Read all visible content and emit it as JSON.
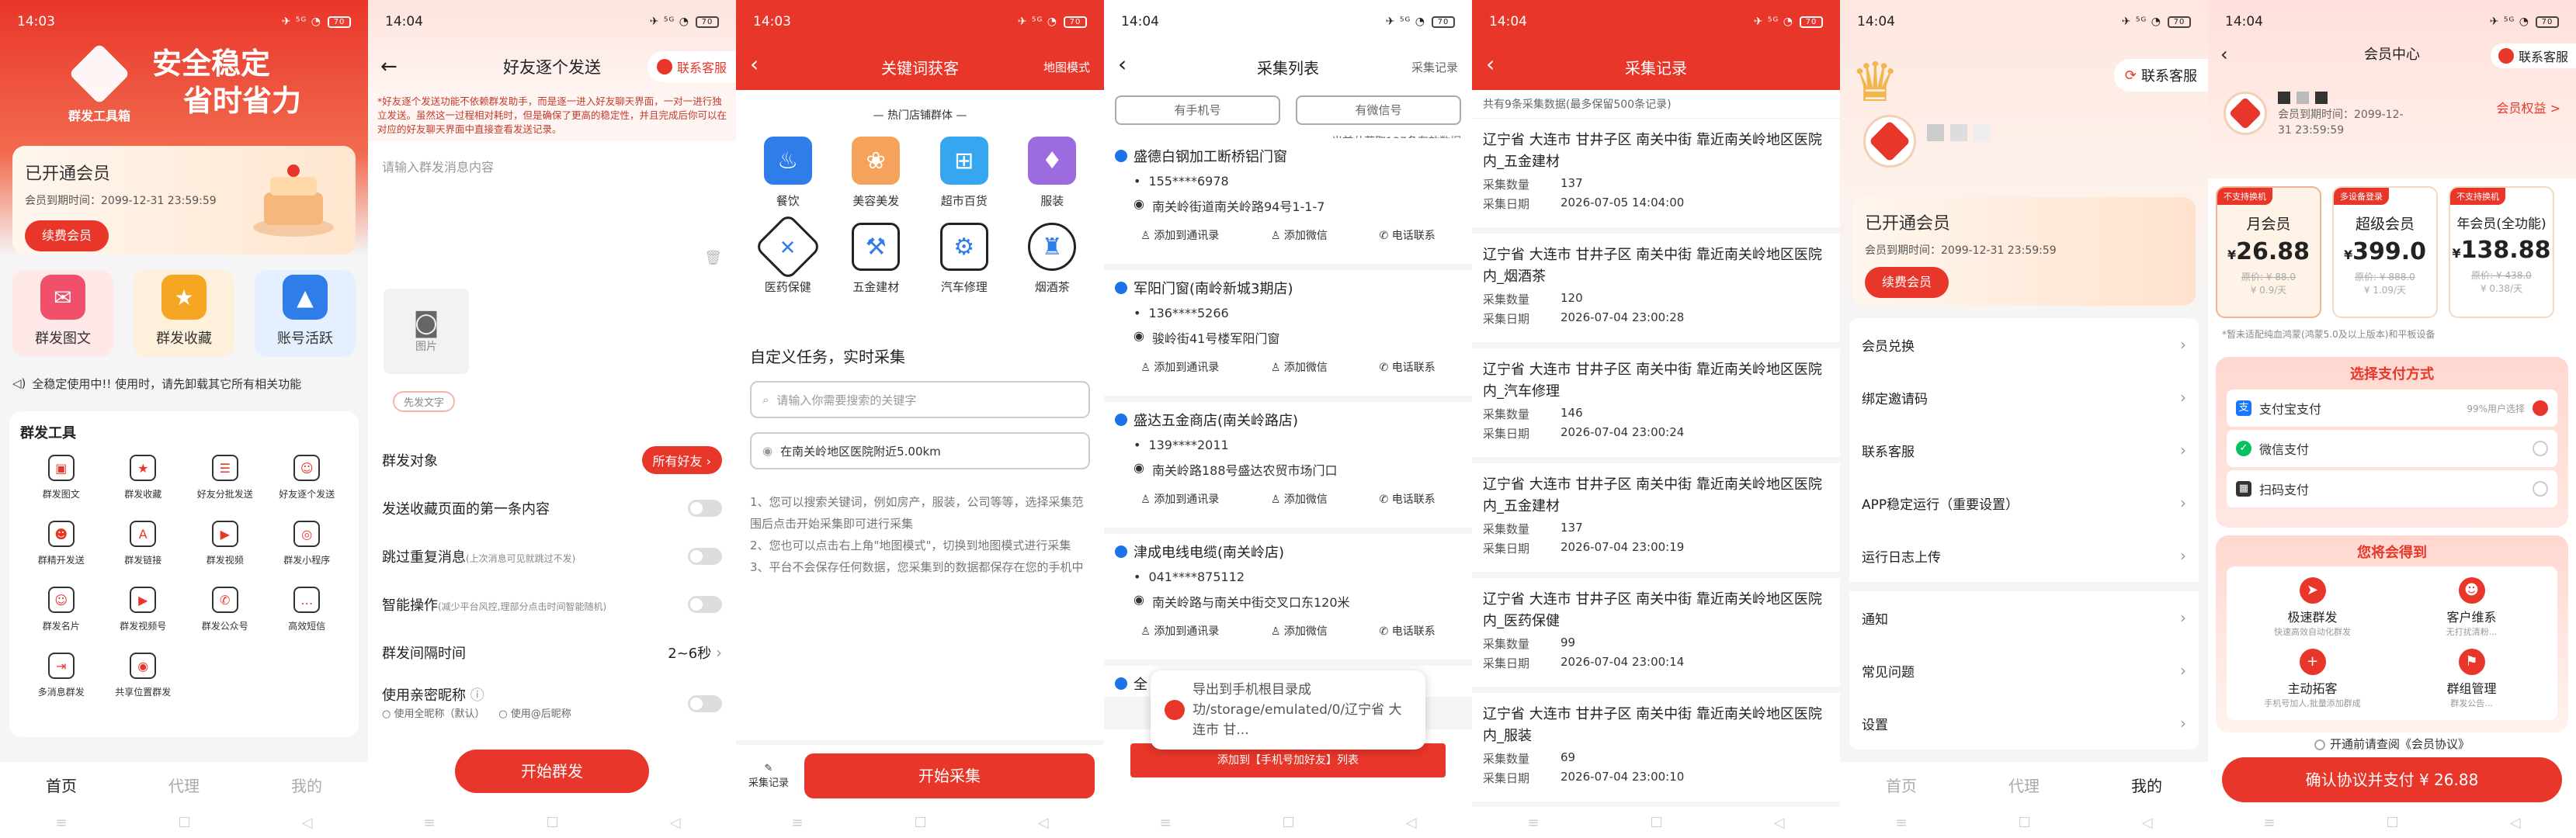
{
  "phone1": {
    "status": {
      "time": "14:03",
      "battery": "70"
    },
    "logo_text": "群发工具箱",
    "slogan_line1": "安全稳定",
    "slogan_line2": "省时省力",
    "member": {
      "title": "已开通会员",
      "expire": "会员到期时间：2099-12-31 23:59:59",
      "renew_button": "续费会员"
    },
    "quick": [
      {
        "label": "群发图文",
        "color": "#f0506b"
      },
      {
        "label": "群发收藏",
        "color": "#f5a623"
      },
      {
        "label": "账号活跃",
        "color": "#2f7de8"
      }
    ],
    "notice": "全稳定使用中!!  使用时，请先卸载其它所有相关功能",
    "tools_title": "群发工具",
    "tools": [
      {
        "label": "群发图文",
        "icon": "image-icon"
      },
      {
        "label": "群发收藏",
        "icon": "star-icon"
      },
      {
        "label": "好友分批发送",
        "icon": "batch-icon"
      },
      {
        "label": "好友逐个发送",
        "icon": "user-icon"
      },
      {
        "label": "群精开发送",
        "icon": "group-icon"
      },
      {
        "label": "群发链接",
        "icon": "link-icon"
      },
      {
        "label": "群发视频",
        "icon": "video-icon"
      },
      {
        "label": "群发小程序",
        "icon": "miniapp-icon"
      },
      {
        "label": "群发名片",
        "icon": "card-icon"
      },
      {
        "label": "群发视频号",
        "icon": "channel-icon"
      },
      {
        "label": "群发公众号",
        "icon": "official-icon"
      },
      {
        "label": "高效短信",
        "icon": "sms-icon"
      },
      {
        "label": "多消息群发",
        "icon": "multi-icon"
      },
      {
        "label": "共享位置群发",
        "icon": "location-icon"
      }
    ],
    "tabs": [
      "首页",
      "代理",
      "我的"
    ]
  },
  "phone2": {
    "status": {
      "time": "14:04",
      "battery": "70"
    },
    "title": "好友逐个发送",
    "cs": "联系客服",
    "desc": "*好友逐个发送功能不依赖群发助手，而是逐一进入好友聊天界面，一对一进行独立发送。虽然这一过程相对耗时，但是确保了更高的稳定性，并且完成后你可以在对应的好友聊天界面中直接查看发送记录。",
    "placeholder": "请输入群发消息内容",
    "image_label": "图片",
    "first_text": "先发文字",
    "rows": [
      {
        "label": "群发对象",
        "value": "所有好友"
      },
      {
        "label": "发送收藏页面的第一条内容"
      },
      {
        "label": "跳过重复消息",
        "sub": "(上次消息可见就跳过不发)"
      },
      {
        "label": "智能操作",
        "sub": "(减少平台风控,理部分点击时间智能随机)"
      },
      {
        "label": "群发间隔时间",
        "value": "2~6秒"
      },
      {
        "label": "使用亲密昵称",
        "opt1": "使用全昵称（默认）",
        "opt2": "使用@后昵称"
      }
    ],
    "send_button": "开始群发"
  },
  "phone3": {
    "status": {
      "time": "14:03",
      "battery": "70"
    },
    "title": "关键词获客",
    "right": "地图模式",
    "hot_title": "热门店铺群体",
    "cats": [
      {
        "label": "餐饮",
        "color": "#2f7de8",
        "icon": "food-icon"
      },
      {
        "label": "美容美发",
        "color": "#f5a35c",
        "icon": "beauty-icon"
      },
      {
        "label": "超市百货",
        "color": "#36a6f0",
        "icon": "cart-icon"
      },
      {
        "label": "服装",
        "color": "#9b6bdf",
        "icon": "shirt-icon"
      },
      {
        "label": "医药保健",
        "color": "#2f7de8",
        "icon": "medicine-icon"
      },
      {
        "label": "五金建材",
        "color": "#2f7de8",
        "icon": "drill-icon"
      },
      {
        "label": "汽车修理",
        "color": "#2f7de8",
        "icon": "wrench-icon"
      },
      {
        "label": "烟酒茶",
        "color": "#2f7de8",
        "icon": "bottle-icon"
      }
    ],
    "custom_title": "自定义任务，实时采集",
    "keyword_placeholder": "请输入你需要搜索的关键字",
    "location": "在南关岭地区医院附近5.00km",
    "tips": [
      "1、您可以搜索关键词，例如房产，服装，公司等等，选择采集范围后点击开始采集即可进行采集",
      "2、您也可以点击右上角\"地图模式\"，切换到地图模式进行采集",
      "3、平台不会保存任何数据，您采集到的数据都保存在您的手机中"
    ],
    "record": "采集记录",
    "start": "开始采集"
  },
  "phone4": {
    "status": {
      "time": "14:04",
      "battery": "70"
    },
    "title": "采集列表",
    "right": "采集记录",
    "tabs": [
      "有手机号",
      "有微信号"
    ],
    "count": "当前共获取137条有效数据",
    "items": [
      {
        "name": "盛德白钢加工断桥铝门窗",
        "phone": "155****6978",
        "addr": "南关岭街道南关岭路94号1-1-7"
      },
      {
        "name": "军阳门窗(南岭新城3期店)",
        "phone": "136****5266",
        "addr": "骏岭街41号楼军阳门窗"
      },
      {
        "name": "盛达五金商店(南关岭路店)",
        "phone": "139****2011",
        "addr": "南关岭路188号盛达农贸市场门口"
      },
      {
        "name": "津成电线电缆(南关岭店)",
        "phone": "041****875112",
        "addr": "南关岭路与南关中街交叉口东120米"
      }
    ],
    "partial": "全",
    "acts": [
      "添加到通讯录",
      "添加微信",
      "电话联系"
    ],
    "toast": "导出到手机根目录成功/storage/emulated/0/辽宁省 大连市 甘...",
    "bottom_button": "添加到【手机号加好友】列表"
  },
  "phone5": {
    "status": {
      "time": "14:04",
      "battery": "70"
    },
    "title": "采集记录",
    "summary": "共有9条采集数据(最多保留500条记录)",
    "k_count": "采集数量",
    "k_date": "采集日期",
    "items": [
      {
        "title": "辽宁省 大连市 甘井子区 南关中街 靠近南关岭地区医院内_五金建材",
        "count": "137",
        "date": "2026-07-05 14:04:00"
      },
      {
        "title": "辽宁省 大连市 甘井子区 南关中街 靠近南关岭地区医院内_烟酒茶",
        "count": "120",
        "date": "2026-07-04 23:00:28"
      },
      {
        "title": "辽宁省 大连市 甘井子区 南关中街 靠近南关岭地区医院内_汽车修理",
        "count": "146",
        "date": "2026-07-04 23:00:24"
      },
      {
        "title": "辽宁省 大连市 甘井子区 南关中街 靠近南关岭地区医院内_五金建材",
        "count": "137",
        "date": "2026-07-04 23:00:19"
      },
      {
        "title": "辽宁省 大连市 甘井子区 南关中街 靠近南关岭地区医院内_医药保健",
        "count": "99",
        "date": "2026-07-04 23:00:14"
      },
      {
        "title": "辽宁省 大连市 甘井子区 南关中街 靠近南关岭地区医院内_服装",
        "count": "69",
        "date": "2026-07-04 23:00:10"
      }
    ]
  },
  "phone6": {
    "status": {
      "time": "14:04",
      "battery": "70"
    },
    "cs": "联系客服",
    "member": {
      "title": "已开通会员",
      "expire": "会员到期时间：2099-12-31 23:59:59",
      "renew_button": "续费会员"
    },
    "menu1": [
      "会员兑换",
      "绑定邀请码",
      "联系客服",
      "APP稳定运行（重要设置）",
      "运行日志上传"
    ],
    "menu2": [
      "通知",
      "常见问题",
      "设置"
    ],
    "tabs": [
      "首页",
      "代理",
      "我的"
    ]
  },
  "phone7": {
    "status": {
      "time": "14:04",
      "battery": "70"
    },
    "title": "会员中心",
    "cs": "联系客服",
    "expire": "会员到期时间：2099-12-31 23:59:59",
    "rights": "会员权益 >",
    "plans": [
      {
        "tag": "不支持换机",
        "name": "月会员",
        "price": "26.88",
        "old": "原价: ¥ 88.0",
        "per": "¥ 0.9/天"
      },
      {
        "tag": "多设备登录",
        "name": "超级会员",
        "price": "399.0",
        "old": "原价: ¥ 888.0",
        "per": "¥ 1.09/天"
      },
      {
        "tag": "不支持换机",
        "name": "年会员(全功能)",
        "price": "138.88",
        "old": "原价: ¥ 438.0",
        "per": "¥ 0.38/天"
      }
    ],
    "currency": "¥",
    "note": "*暂未适配纯血鸿蒙(鸿蒙5.0及以上版本)和平板设备",
    "pay_title": "选择支付方式",
    "pay": [
      {
        "label": "支付宝支付",
        "note": "99%用户选择",
        "color": "#1677ff",
        "selected": true
      },
      {
        "label": "微信支付",
        "note": "",
        "color": "#07c160",
        "selected": false
      },
      {
        "label": "扫码支付",
        "note": "",
        "color": "#333333",
        "selected": false
      }
    ],
    "gain_title": "您将会得到",
    "gains": [
      {
        "title": "极速群发",
        "sub": "快速高效自动化群发"
      },
      {
        "title": "客户维系",
        "sub": "无打扰清粉..."
      },
      {
        "title": "主动拓客",
        "sub": "手机号加人,批量添加群成"
      },
      {
        "title": "群组管理",
        "sub": "群发公告..."
      }
    ],
    "agree": "开通前请查阅《会员协议》",
    "confirm": "确认协议并支付 ¥ 26.88"
  }
}
